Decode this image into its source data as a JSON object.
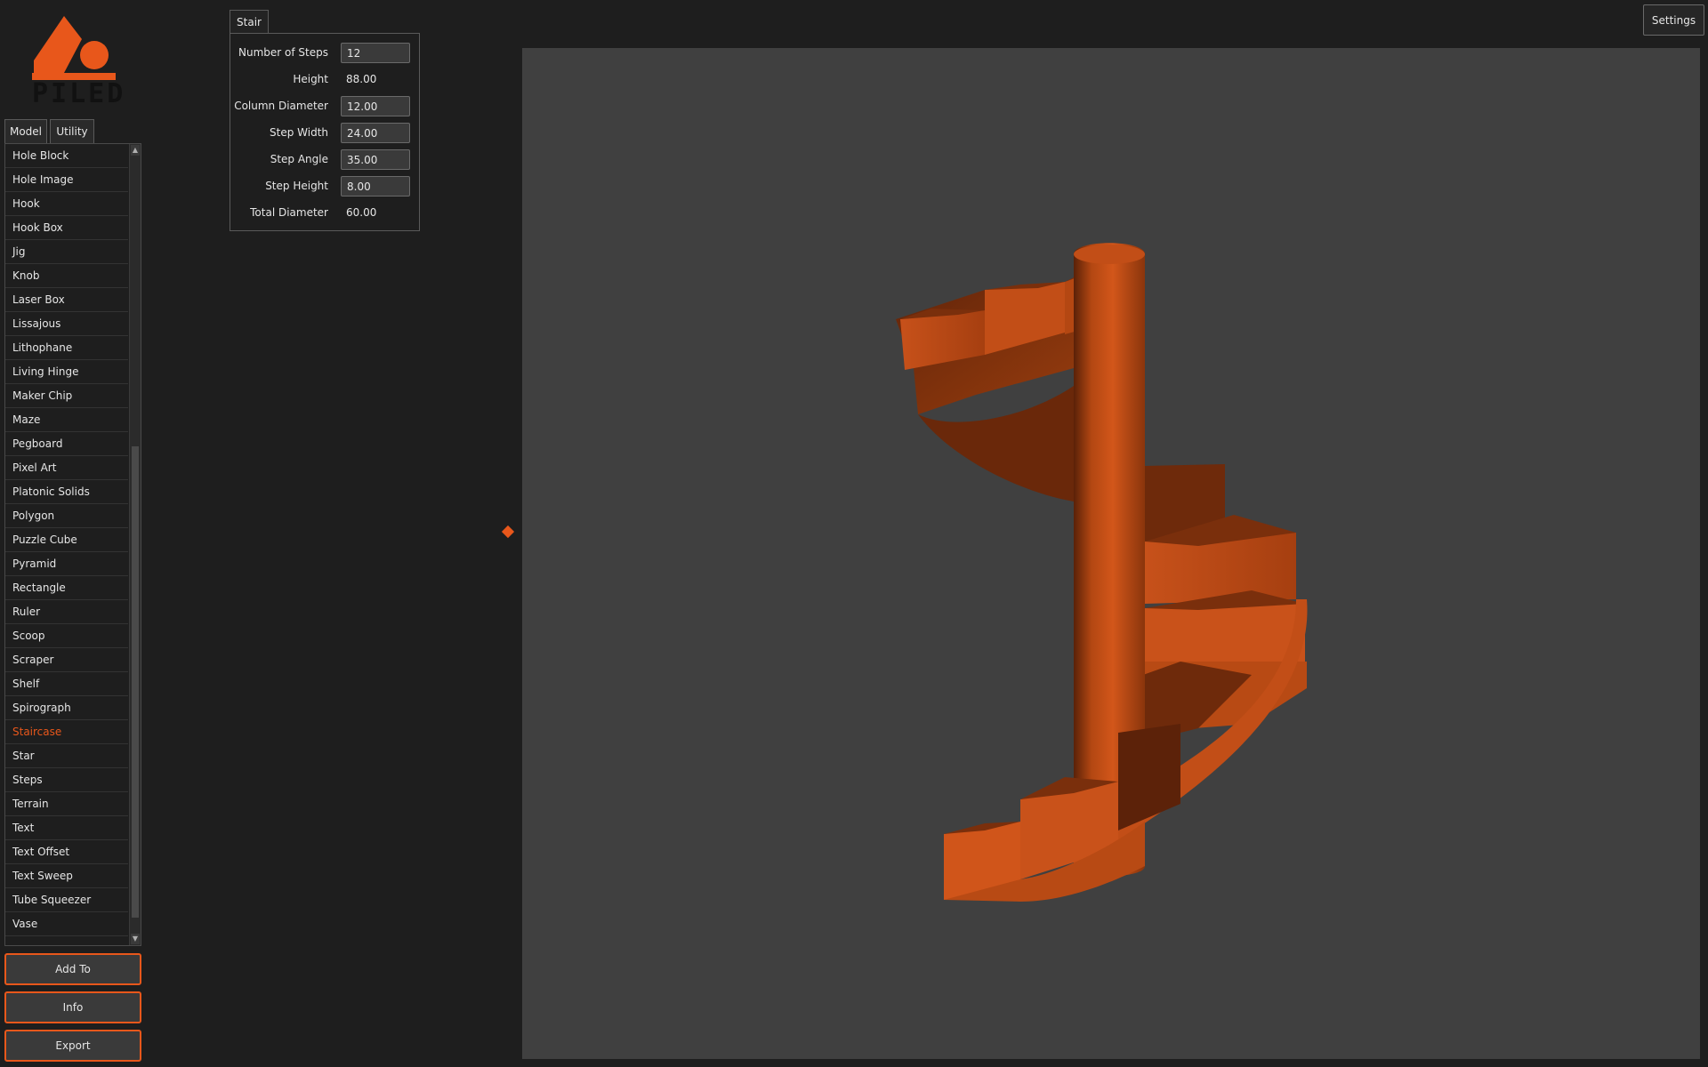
{
  "logo": {
    "text": "PILED"
  },
  "tabs": [
    {
      "label": "",
      "icon": "home-icon"
    },
    {
      "label": "Utility"
    },
    {
      "label": "Model"
    }
  ],
  "model_list": [
    "Hole Block",
    "Hole Image",
    "Hook",
    "Hook Box",
    "Jig",
    "Knob",
    "Laser Box",
    "Lissajous",
    "Lithophane",
    "Living Hinge",
    "Maker Chip",
    "Maze",
    "Pegboard",
    "Pixel Art",
    "Platonic Solids",
    "Polygon",
    "Puzzle Cube",
    "Pyramid",
    "Rectangle",
    "Ruler",
    "Scoop",
    "Scraper",
    "Shelf",
    "Spirograph",
    "Staircase",
    "Star",
    "Steps",
    "Terrain",
    "Text",
    "Text Offset",
    "Text Sweep",
    "Tube Squeezer",
    "Vase"
  ],
  "selected_model": "Staircase",
  "actions": {
    "add_to": "Add To",
    "info": "Info",
    "export": "Export"
  },
  "settings_label": "Settings",
  "params": {
    "tab_label": "Stair",
    "number_of_steps": {
      "label": "Number of Steps",
      "value": "12"
    },
    "height": {
      "label": "Height",
      "value": "88.00"
    },
    "column_diameter": {
      "label": "Column Diameter",
      "value": "12.00"
    },
    "step_width": {
      "label": "Step Width",
      "value": "24.00"
    },
    "step_angle": {
      "label": "Step Angle",
      "value": "35.00"
    },
    "step_height": {
      "label": "Step Height",
      "value": "8.00"
    },
    "total_diameter": {
      "label": "Total Diameter",
      "value": "60.00"
    }
  },
  "colors": {
    "accent": "#e8571b",
    "background": "#1e1e1e",
    "viewport": "#404040",
    "model_light": "#d2561a",
    "model_dark": "#7a2f0c"
  }
}
